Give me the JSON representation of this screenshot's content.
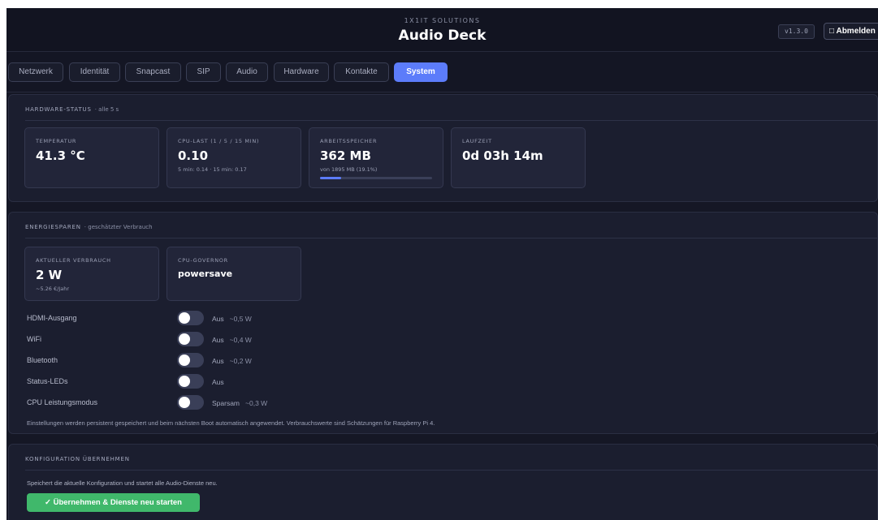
{
  "header": {
    "company": "1X1IT SOLUTIONS",
    "title": "Audio Deck",
    "version": "v1.3.0",
    "logout_icon": "□",
    "logout_label": "Abmelden"
  },
  "tabs": [
    {
      "label": "Netzwerk",
      "active": false
    },
    {
      "label": "Identität",
      "active": false
    },
    {
      "label": "Snapcast",
      "active": false
    },
    {
      "label": "SIP",
      "active": false
    },
    {
      "label": "Audio",
      "active": false
    },
    {
      "label": "Hardware",
      "active": false
    },
    {
      "label": "Kontakte",
      "active": false
    },
    {
      "label": "System",
      "active": true
    }
  ],
  "hardware_status": {
    "title": "HARDWARE-STATUS",
    "note": "· alle 5 s",
    "cards": {
      "temperature": {
        "label": "TEMPERATUR",
        "value": "41.3 °C"
      },
      "cpu": {
        "label": "CPU-LAST (1 / 5 / 15 MIN)",
        "value": "0.10",
        "sub": "5 min: 0.14 · 15 min: 0.17"
      },
      "memory": {
        "label": "ARBEITSSPEICHER",
        "value": "362 MB",
        "sub": "von 1895 MB (19.1%)",
        "usage_percent": 19.1
      },
      "uptime": {
        "label": "LAUFZEIT",
        "value": "0d 03h 14m"
      }
    }
  },
  "energy": {
    "title": "ENERGIESPAREN",
    "note": "· geschätzter Verbrauch",
    "consumption": {
      "label": "AKTUELLER VERBRAUCH",
      "value": "2 W",
      "sub": "~5.26 €/Jahr"
    },
    "governor": {
      "label": "CPU-GOVERNOR",
      "value": "powersave"
    },
    "toggles": [
      {
        "label": "HDMI-Ausgang",
        "state": "Aus",
        "watt": "~0,5 W",
        "on": false
      },
      {
        "label": "WiFi",
        "state": "Aus",
        "watt": "~0,4 W",
        "on": false
      },
      {
        "label": "Bluetooth",
        "state": "Aus",
        "watt": "~0,2 W",
        "on": false
      },
      {
        "label": "Status-LEDs",
        "state": "Aus",
        "watt": "",
        "on": false
      },
      {
        "label": "CPU Leistungsmodus",
        "state": "Sparsam",
        "watt": "~0,3 W",
        "on": false
      }
    ],
    "footnote": "Einstellungen werden persistent gespeichert und beim nächsten Boot automatisch angewendet. Verbrauchswerte sind Schätzungen für Raspberry Pi 4."
  },
  "apply": {
    "title": "KONFIGURATION ÜBERNEHMEN",
    "description": "Speichert die aktuelle Konfiguration und startet alle Audio-Dienste neu.",
    "button_label": "✓ Übernehmen & Dienste neu starten"
  },
  "colors": {
    "accent": "#5c7cfa",
    "success": "#40b86b",
    "background": "#151725"
  }
}
